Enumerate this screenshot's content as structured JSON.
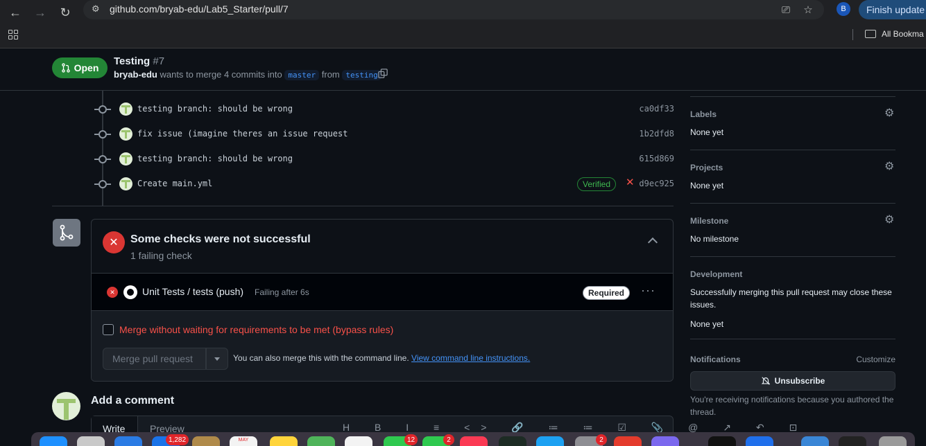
{
  "browser": {
    "url": "github.com/bryab-edu/Lab5_Starter/pull/7",
    "profile_initial": "B",
    "finish_update_label": "Finish update",
    "bookmarks_label": "All Bookma"
  },
  "pr": {
    "state": "Open",
    "title": "Testing",
    "number": "#7",
    "author": "bryab-edu",
    "merge_text": "wants to merge 4 commits into",
    "base_branch": "master",
    "from_text": "from",
    "head_branch": "testing"
  },
  "commits": [
    {
      "message": "testing branch: should be wrong",
      "sha": "ca0df33"
    },
    {
      "message": "fix issue (imagine theres an issue request",
      "sha": "1b2dfd8"
    },
    {
      "message": "testing branch: should be wrong",
      "sha": "615d869"
    },
    {
      "message": "Create main.yml",
      "sha": "d9ec925",
      "verified": "Verified"
    }
  ],
  "checks": {
    "title": "Some checks were not successful",
    "subtitle": "1 failing check",
    "row": {
      "name": "Unit Tests / tests (push)",
      "status": "Failing after 6s",
      "badge": "Required"
    },
    "bypass_label": "Merge without waiting for requirements to be met (bypass rules)",
    "merge_button": "Merge pull request",
    "merge_note": "You can also merge this with the command line.",
    "merge_link": "View command line instructions."
  },
  "comment": {
    "title": "Add a comment",
    "tab_write": "Write",
    "tab_preview": "Preview",
    "toolbar": "H B I ≡ <> 🔗 ≔ ≔ ☑ 📎 @ ↗ ↶ ⊡"
  },
  "sidebar": {
    "labels": {
      "title": "Labels",
      "value": "None yet"
    },
    "projects": {
      "title": "Projects",
      "value": "None yet"
    },
    "milestone": {
      "title": "Milestone",
      "value": "No milestone"
    },
    "development": {
      "title": "Development",
      "value": "Successfully merging this pull request may close these issues.",
      "value2": "None yet"
    },
    "notifications": {
      "title": "Notifications",
      "customize": "Customize",
      "button": "Unsubscribe",
      "note": "You're receiving notifications because you authored the thread."
    }
  },
  "dock": {
    "badges": [
      "1,282",
      "12",
      "2",
      "2"
    ],
    "calendar_month": "MAY"
  },
  "colors": {
    "open_green": "#238636",
    "danger_red": "#da3633",
    "link_blue": "#4493f8",
    "bg": "#0d1117"
  }
}
